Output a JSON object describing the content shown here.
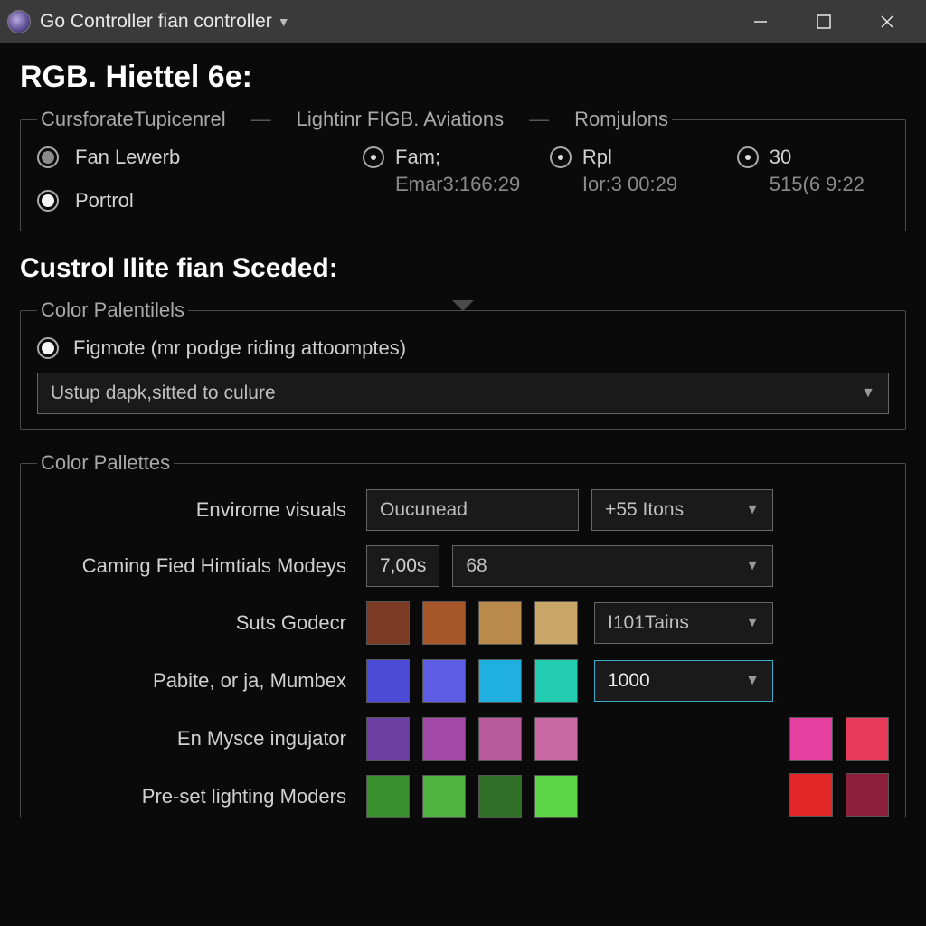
{
  "titlebar": {
    "app_title": "Go Controller fian controller"
  },
  "page_title": "RGB. Hiettel 6e:",
  "top_panel": {
    "legends": [
      "CursforateTupicenrel",
      "Lightinr FIGB. Aviations",
      "Romjulons"
    ],
    "left_options": [
      {
        "label": "Fan Lewerb"
      },
      {
        "label": "Portrol"
      }
    ],
    "columns": [
      {
        "head": "Fam;",
        "sub": "Emar3:166:29"
      },
      {
        "head": "Rpl",
        "sub": "Ior:3 00:29"
      },
      {
        "head": "30",
        "sub": "515(6 9:22"
      }
    ]
  },
  "section2_title": "Custrol Ilite fian Sceded:",
  "palentilels": {
    "legend": "Color Palentilels",
    "option_label": "Figmote (mr podge riding attoomptes)",
    "combo_value": "Ustup dapk,sitted to culure"
  },
  "palettes": {
    "legend": "Color Pallettes",
    "rows": {
      "envirome": {
        "label": "Envirome visuals",
        "left_value": "Oucunead",
        "right_value": "+55 Itons"
      },
      "gaming": {
        "label": "Caming Fied Himtials Modeys",
        "left_value": "7,00s",
        "right_value": "68"
      },
      "suts": {
        "label": "Suts Godecr",
        "combo_value": "I101Tains"
      },
      "pabite": {
        "label": "Pabite, or ja, Mumbex",
        "combo_value": "1000"
      },
      "en_mysce": {
        "label": "En Mysce ingujator"
      },
      "preset": {
        "label": "Pre-set lighting Moders"
      }
    },
    "swatches": {
      "row_suts": [
        "#7a3a24",
        "#a8572b",
        "#b98a4a",
        "#c9a768"
      ],
      "row_pabite": [
        "#4b4bd6",
        "#5d5de6",
        "#1fb0e0",
        "#22ccb0"
      ],
      "row_mysce": [
        "#6e3fa3",
        "#a24aa6",
        "#b85a9c",
        "#c96aa6"
      ],
      "row_preset": [
        "#3a8f2f",
        "#4fb43f",
        "#2f6f27",
        "#5fd648"
      ],
      "right_tiles": [
        "#e53fa0",
        "#ea3a5a",
        "#e02626",
        "#8e1f3c"
      ]
    }
  }
}
